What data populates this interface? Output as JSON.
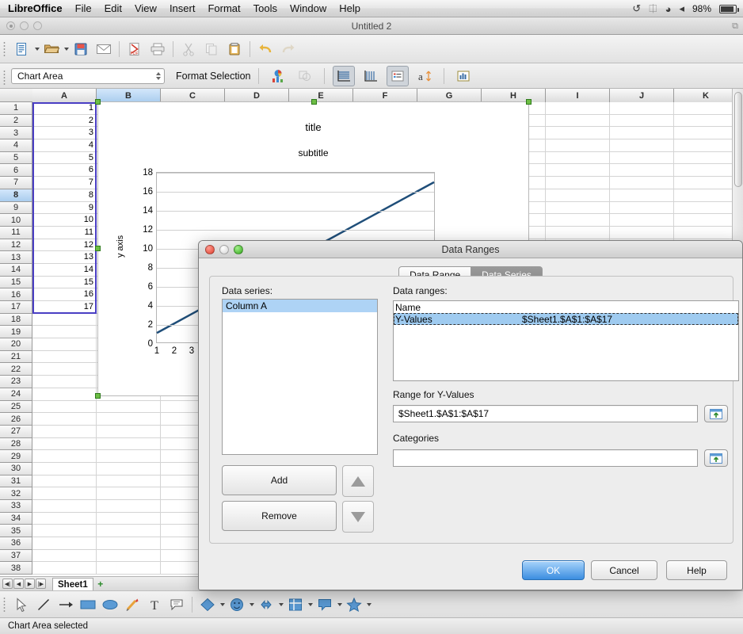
{
  "macbar": {
    "app_name": "LibreOffice",
    "menus": [
      "File",
      "Edit",
      "View",
      "Insert",
      "Format",
      "Tools",
      "Window",
      "Help"
    ],
    "status_icons": [
      "time-machine-icon",
      "bluetooth-icon",
      "wifi-icon",
      "volume-icon"
    ],
    "battery_percent": "98%"
  },
  "window": {
    "title": "Untitled 2"
  },
  "toolbar": {
    "items": [
      {
        "name": "new-document-icon",
        "dropdown": true
      },
      {
        "name": "open-file-icon",
        "dropdown": true
      },
      {
        "name": "save-icon",
        "dropdown": false
      },
      {
        "name": "email-icon",
        "dropdown": false
      },
      {
        "name": "export-pdf-icon",
        "dropdown": false
      },
      {
        "name": "print-icon",
        "dropdown": false
      },
      {
        "name": "cut-icon",
        "dropdown": false
      },
      {
        "name": "copy-icon",
        "dropdown": false
      },
      {
        "name": "paste-icon",
        "dropdown": false
      },
      {
        "name": "undo-icon",
        "dropdown": false
      },
      {
        "name": "redo-icon",
        "dropdown": false
      }
    ],
    "chart_element_value": "Chart Area",
    "format_selection_label": "Format Selection",
    "chart_items": [
      {
        "name": "chart-type-icon",
        "selected": false,
        "disabled": false
      },
      {
        "name": "data-table-icon",
        "selected": false,
        "disabled": true
      },
      {
        "name": "horizontal-grids-icon",
        "selected": true,
        "disabled": false
      },
      {
        "name": "vertical-grids-icon",
        "selected": false,
        "disabled": false
      },
      {
        "name": "legend-on-off-icon",
        "selected": true,
        "disabled": false
      },
      {
        "name": "scale-text-icon",
        "selected": false,
        "disabled": false
      },
      {
        "name": "automatic-layout-icon",
        "selected": false,
        "disabled": false
      }
    ]
  },
  "sheet": {
    "columns": [
      "A",
      "B",
      "C",
      "D",
      "E",
      "F",
      "G",
      "H",
      "I",
      "J",
      "K"
    ],
    "highlighted_column": "B",
    "highlighted_row": 8,
    "rows": [
      1,
      2,
      3,
      4,
      5,
      6,
      7,
      8,
      9,
      10,
      11,
      12,
      13,
      14,
      15,
      16,
      17,
      18,
      19,
      20,
      21,
      22,
      23,
      24,
      25,
      26,
      27,
      28,
      29,
      30,
      31,
      32,
      33,
      34,
      35,
      36,
      37,
      38
    ],
    "column_a_values": [
      "1",
      "2",
      "3",
      "4",
      "5",
      "6",
      "7",
      "8",
      "9",
      "10",
      "11",
      "12",
      "13",
      "14",
      "15",
      "16",
      "17"
    ],
    "tab_name": "Sheet1",
    "add_sheet_label": "+"
  },
  "chart_data": {
    "type": "line",
    "title": "title",
    "subtitle": "subtitle",
    "xlabel": "",
    "ylabel": "y axis",
    "x": [
      1,
      2,
      3,
      4,
      5,
      6,
      7,
      8,
      9,
      10,
      11,
      12,
      13,
      14,
      15,
      16,
      17
    ],
    "values": [
      1,
      2,
      3,
      4,
      5,
      6,
      7,
      8,
      9,
      10,
      11,
      12,
      13,
      14,
      15,
      16,
      17
    ],
    "series": [
      {
        "name": "Column A",
        "values": [
          1,
          2,
          3,
          4,
          5,
          6,
          7,
          8,
          9,
          10,
          11,
          12,
          13,
          14,
          15,
          16,
          17
        ]
      }
    ],
    "yticks": [
      0,
      2,
      4,
      6,
      8,
      10,
      12,
      14,
      16,
      18
    ],
    "xticks_visible": [
      1,
      2,
      3
    ],
    "ylim": [
      0,
      18
    ],
    "xlim": [
      1,
      17
    ],
    "grid": true,
    "legend_position": "none",
    "line_color": "#1f4e79"
  },
  "dialog": {
    "title": "Data Ranges",
    "tabs": [
      {
        "label": "Data Range",
        "active": false
      },
      {
        "label": "Data Series",
        "active": true
      }
    ],
    "data_series_label": "Data series:",
    "data_series_items": [
      {
        "label": "Column A",
        "selected": true
      }
    ],
    "data_ranges_label": "Data ranges:",
    "data_ranges_header": "Name",
    "data_ranges_rows": [
      {
        "name": "Y-Values",
        "range": "$Sheet1.$A$1:$A$17",
        "selected": true
      }
    ],
    "range_for_label": "Range for Y-Values",
    "range_for_value": "$Sheet1.$A$1:$A$17",
    "categories_label": "Categories",
    "categories_value": "",
    "add_label": "Add",
    "remove_label": "Remove",
    "move_up_icon": "triangle-up-icon",
    "move_down_icon": "triangle-down-icon",
    "select_range_icon": "select-range-icon",
    "ok_label": "OK",
    "cancel_label": "Cancel",
    "help_label": "Help"
  },
  "drawbar": {
    "items": [
      {
        "name": "select-arrow-icon",
        "dropdown": false
      },
      {
        "name": "line-icon",
        "dropdown": false
      },
      {
        "name": "arrow-line-icon",
        "dropdown": false
      },
      {
        "name": "rectangle-icon",
        "dropdown": false
      },
      {
        "name": "ellipse-icon",
        "dropdown": false
      },
      {
        "name": "freeform-line-icon",
        "dropdown": false
      },
      {
        "name": "text-box-icon",
        "dropdown": false
      },
      {
        "name": "callout-icon",
        "dropdown": false
      },
      {
        "name": "basic-shapes-icon",
        "dropdown": true
      },
      {
        "name": "symbol-shapes-icon",
        "dropdown": true
      },
      {
        "name": "block-arrows-icon",
        "dropdown": true
      },
      {
        "name": "flowchart-icon",
        "dropdown": true
      },
      {
        "name": "callout-shapes-icon",
        "dropdown": true
      },
      {
        "name": "stars-icon",
        "dropdown": true
      }
    ]
  },
  "statusbar": {
    "text": "Chart Area selected"
  }
}
